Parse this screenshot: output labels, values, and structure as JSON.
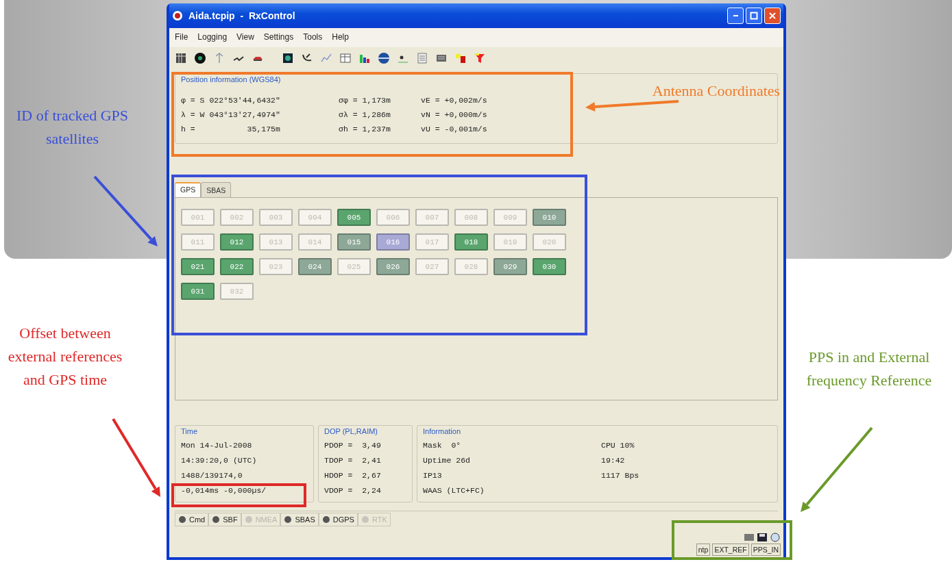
{
  "window": {
    "title": "Aida.tcpip  -  RxControl"
  },
  "menu": [
    "File",
    "Logging",
    "View",
    "Settings",
    "Tools",
    "Help"
  ],
  "position": {
    "title": "Position information (WGS84)",
    "rows": [
      [
        "φ = S 022°53'44,6432\"",
        "σφ = 1,173m",
        "vE = +0,002m/s"
      ],
      [
        "λ = W 043°13'27,4974\"",
        "σλ = 1,286m",
        "vN = +0,000m/s"
      ],
      [
        "h =           35,175m",
        "σh = 1,237m",
        "vU = -0,001m/s"
      ]
    ]
  },
  "satellites": {
    "tabs": [
      {
        "label": "GPS",
        "selected": true
      },
      {
        "label": "SBAS",
        "selected": false
      }
    ],
    "items": [
      {
        "id": "001",
        "color": "#f6f4ec"
      },
      {
        "id": "002",
        "color": "#f6f4ec"
      },
      {
        "id": "003",
        "color": "#f6f4ec"
      },
      {
        "id": "004",
        "color": "#f6f4ec"
      },
      {
        "id": "005",
        "color": "#5aa56e"
      },
      {
        "id": "006",
        "color": "#f6f4ec"
      },
      {
        "id": "007",
        "color": "#f6f4ec"
      },
      {
        "id": "008",
        "color": "#f6f4ec"
      },
      {
        "id": "009",
        "color": "#f6f4ec"
      },
      {
        "id": "010",
        "color": "#8ea898"
      },
      {
        "id": "011",
        "color": "#f6f4ec"
      },
      {
        "id": "012",
        "color": "#5aa56e"
      },
      {
        "id": "013",
        "color": "#f6f4ec"
      },
      {
        "id": "014",
        "color": "#f6f4ec"
      },
      {
        "id": "015",
        "color": "#8ea898"
      },
      {
        "id": "016",
        "color": "#a9a9d6"
      },
      {
        "id": "017",
        "color": "#f6f4ec"
      },
      {
        "id": "018",
        "color": "#5aa56e"
      },
      {
        "id": "019",
        "color": "#f6f4ec"
      },
      {
        "id": "020",
        "color": "#f6f4ec"
      },
      {
        "id": "021",
        "color": "#5aa56e"
      },
      {
        "id": "022",
        "color": "#5aa56e"
      },
      {
        "id": "023",
        "color": "#f6f4ec"
      },
      {
        "id": "024",
        "color": "#8ea898"
      },
      {
        "id": "025",
        "color": "#f6f4ec"
      },
      {
        "id": "026",
        "color": "#8ea898"
      },
      {
        "id": "027",
        "color": "#f6f4ec"
      },
      {
        "id": "028",
        "color": "#f6f4ec"
      },
      {
        "id": "029",
        "color": "#8ea898"
      },
      {
        "id": "030",
        "color": "#5aa56e"
      },
      {
        "id": "031",
        "color": "#5aa56e"
      },
      {
        "id": "032",
        "color": "#f6f4ec"
      }
    ]
  },
  "time": {
    "title": "Time",
    "lines": [
      "Mon 14-Jul-2008",
      "14:39:20,0 (UTC)",
      "1488/139174,0",
      "-0,014ms -0,000µs/"
    ]
  },
  "dop": {
    "title": "DOP (PL,RAIM)",
    "lines": [
      "PDOP =  3,49",
      "TDOP =  2,41",
      "HDOP =  2,67",
      "VDOP =  2,24"
    ]
  },
  "information": {
    "title": "Information",
    "lines": [
      "Mask  0°",
      "Uptime 26d",
      "IP13",
      "WAAS (LTC+FC)"
    ],
    "lines_2": [
      "CPU 10%",
      "19:42",
      "1117 Bps"
    ]
  },
  "stream_tabs": [
    {
      "label": "Cmd",
      "disabled": false
    },
    {
      "label": "SBF",
      "disabled": false
    },
    {
      "label": "NMEA",
      "disabled": true
    },
    {
      "label": "SBAS",
      "disabled": false
    },
    {
      "label": "DGPS",
      "disabled": false
    },
    {
      "label": "RTK",
      "disabled": true
    }
  ],
  "status_panes": [
    "ntp",
    "EXT_REF",
    "PPS_IN"
  ],
  "annotations": [
    {
      "text": "ID of  tracked GPS satellites",
      "color": "#3a4fd8"
    },
    {
      "text": "Antenna Coordinates",
      "color": "#f07a2a"
    },
    {
      "text": "Offset between external references  and GPS time",
      "color": "#e02828"
    },
    {
      "text": "PPS in and External frequency Reference",
      "color": "#6a9a2a"
    }
  ]
}
